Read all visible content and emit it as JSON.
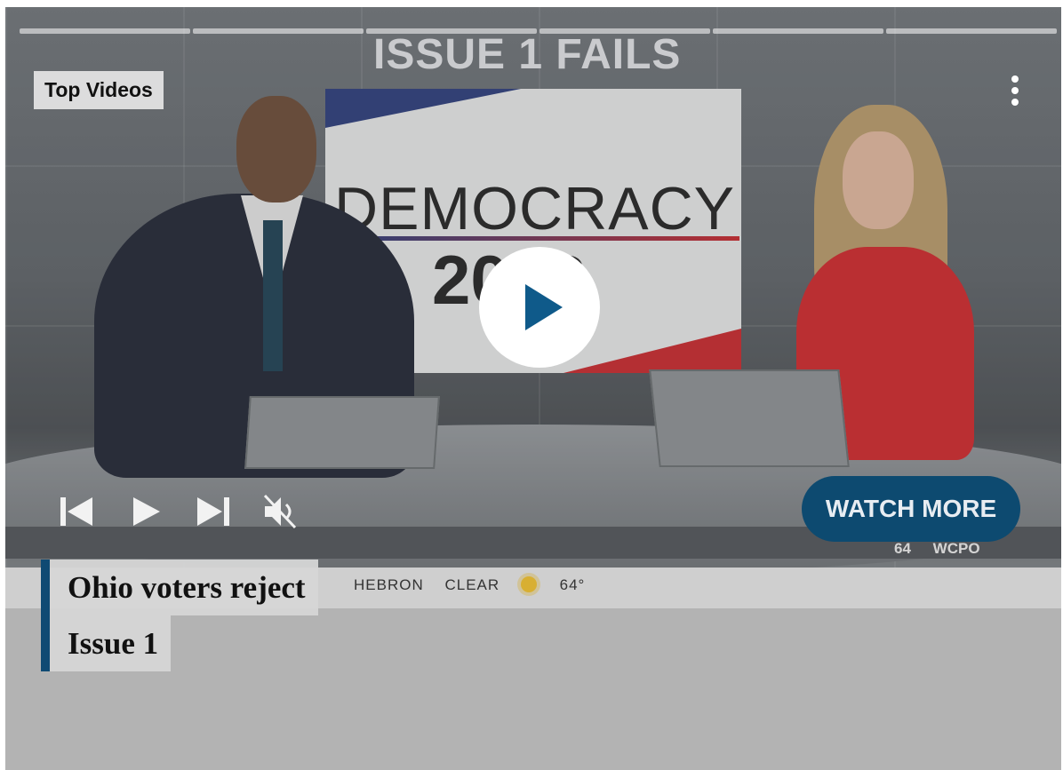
{
  "player": {
    "section_label": "Top Videos",
    "progress_segments": 6,
    "menu_icon": "more-vertical-icon",
    "play_icon": "play-icon",
    "controls": {
      "previous_icon": "skip-previous-icon",
      "play_icon": "play-icon",
      "next_icon": "skip-next-icon",
      "mute_icon": "volume-muted-icon"
    },
    "watch_more_label": "WATCH MORE",
    "headline_line1": "Ohio voters reject",
    "headline_line2": "Issue 1"
  },
  "video_frame": {
    "story_tag": "ISSUE 1 FAILS",
    "graphic_word": "DEMOCRACY",
    "graphic_year": "2023",
    "ticker_location": "HEBRON",
    "ticker_condition": "CLEAR",
    "ticker_temp": "64°",
    "bug_temp": "64",
    "station": "WCPO"
  },
  "colors": {
    "accent": "#0d4a70",
    "play_triangle": "#0f5a8a",
    "headline_bar": "#0f4a73"
  }
}
